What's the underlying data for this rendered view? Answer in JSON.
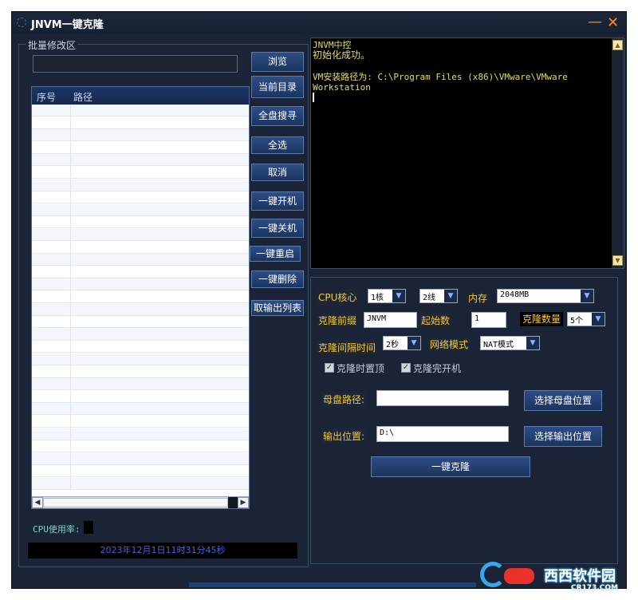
{
  "window": {
    "title": "JNVM一键克隆",
    "minimize": "—",
    "close": "✕"
  },
  "batch": {
    "group_label": "批量修改区",
    "path_value": "",
    "columns": [
      "序号",
      "路径"
    ],
    "row_count": 31
  },
  "buttons": {
    "browse": "浏览",
    "current_dir": "当前目录",
    "full_search": "全盘搜寻",
    "select_all": "全选",
    "cancel": "取消",
    "power_on": "一键开机",
    "power_off": "一键关机",
    "restart": "一键重启",
    "delete": "一键删除",
    "export_list": "取输出列表"
  },
  "status": {
    "cpu_label": "CPU使用率:",
    "datetime": "2023年12月1日11时31分45秒"
  },
  "console": {
    "line1": "JNVM中控",
    "line2": "初始化成功。",
    "line3": "VM安装路径为: C:\\Program Files (x86)\\VMware\\VMware",
    "line4": "Workstation"
  },
  "settings": {
    "cpu_label": "CPU核心",
    "cpu_core": "1核",
    "cpu_thread": "2线",
    "mem_label": "内存",
    "mem_value": "2048MB",
    "prefix_label": "克隆前缀",
    "prefix_value": "JNVM",
    "start_label": "起始数",
    "start_value": "1",
    "count_label": "克隆数量",
    "count_value": "5个",
    "interval_label": "克隆间隔时间",
    "interval_value": "2秒",
    "net_label": "网络模式",
    "net_value": "NAT模式",
    "chk_top_label": "克隆时置顶",
    "chk_boot_label": "克隆完开机",
    "parent_label": "母盘路径:",
    "parent_value": "",
    "parent_button": "选择母盘位置",
    "output_label": "输出位置:",
    "output_value": "D:\\",
    "output_button": "选择输出位置",
    "clone_button": "一键克隆"
  },
  "watermark": {
    "brand": "西西软件园",
    "url": "CR173.COM"
  }
}
